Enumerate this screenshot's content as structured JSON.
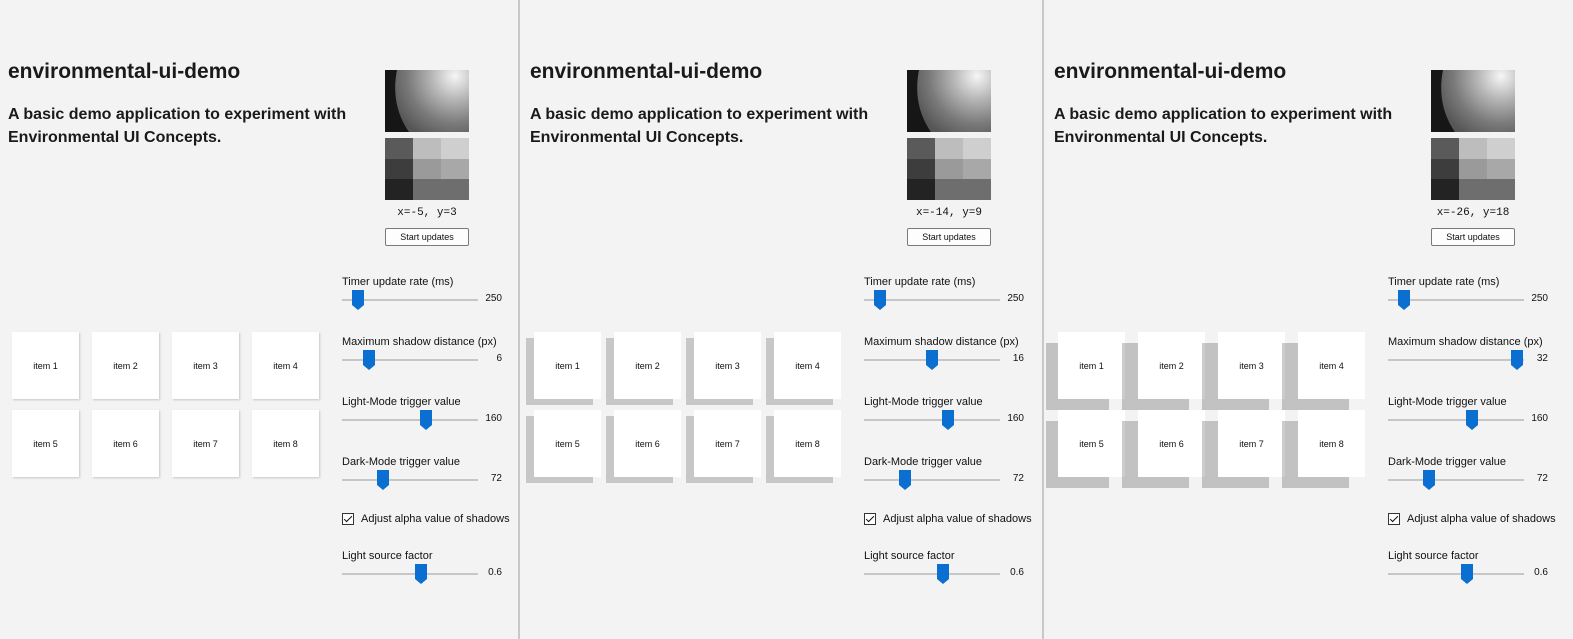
{
  "panels": [
    {
      "title": "environmental-ui-demo",
      "subtitle": "A basic demo application to experiment with Environmental UI Concepts.",
      "coords": "x=-5, y=3",
      "start_button": "Start updates",
      "sliders": [
        {
          "label": "Timer update rate (ms)",
          "value": "250",
          "level": 0.12
        },
        {
          "label": "Maximum shadow distance (px)",
          "value": "6",
          "level": 0.2
        },
        {
          "label": "Light-Mode trigger value",
          "value": "160",
          "level": 0.62
        },
        {
          "label": "Dark-Mode trigger value",
          "value": "72",
          "level": 0.3
        }
      ],
      "checkbox": {
        "label": "Adjust alpha value of shadows",
        "checked": true
      },
      "light_factor": {
        "label": "Light source factor",
        "value": "0.6",
        "level": 0.58
      },
      "items": [
        "item 1",
        "item 2",
        "item 3",
        "item 4",
        "item 5",
        "item 6",
        "item 7",
        "item 8"
      ]
    },
    {
      "title": "environmental-ui-demo",
      "subtitle": "A basic demo application to experiment with Environmental UI Concepts.",
      "coords": "x=-14, y=9",
      "start_button": "Start updates",
      "sliders": [
        {
          "label": "Timer update rate (ms)",
          "value": "250",
          "level": 0.12
        },
        {
          "label": "Maximum shadow distance (px)",
          "value": "16",
          "level": 0.5
        },
        {
          "label": "Light-Mode trigger value",
          "value": "160",
          "level": 0.62
        },
        {
          "label": "Dark-Mode trigger value",
          "value": "72",
          "level": 0.3
        }
      ],
      "checkbox": {
        "label": "Adjust alpha value of shadows",
        "checked": true
      },
      "light_factor": {
        "label": "Light source factor",
        "value": "0.6",
        "level": 0.58
      },
      "items": [
        "item 1",
        "item 2",
        "item 3",
        "item 4",
        "item 5",
        "item 6",
        "item 7",
        "item 8"
      ]
    },
    {
      "title": "environmental-ui-demo",
      "subtitle": "A basic demo application to experiment with Environmental UI Concepts.",
      "coords": "x=-26, y=18",
      "start_button": "Start updates",
      "sliders": [
        {
          "label": "Timer update rate (ms)",
          "value": "250",
          "level": 0.12
        },
        {
          "label": "Maximum shadow distance (px)",
          "value": "32",
          "level": 0.95
        },
        {
          "label": "Light-Mode trigger value",
          "value": "160",
          "level": 0.62
        },
        {
          "label": "Dark-Mode trigger value",
          "value": "72",
          "level": 0.3
        }
      ],
      "checkbox": {
        "label": "Adjust alpha value of shadows",
        "checked": true
      },
      "light_factor": {
        "label": "Light source factor",
        "value": "0.6",
        "level": 0.58
      },
      "items": [
        "item 1",
        "item 2",
        "item 3",
        "item 4",
        "item 5",
        "item 6",
        "item 7",
        "item 8"
      ]
    }
  ],
  "colors": {
    "accent": "#0a6fd1",
    "grid_tones": [
      "#5a5a5a",
      "#bdbdbd",
      "#cfcfcf",
      "#3d3d3d",
      "#9a9a9a",
      "#a8a8a8",
      "#232323",
      "#6e6e6e",
      "#6e6e6e"
    ]
  }
}
